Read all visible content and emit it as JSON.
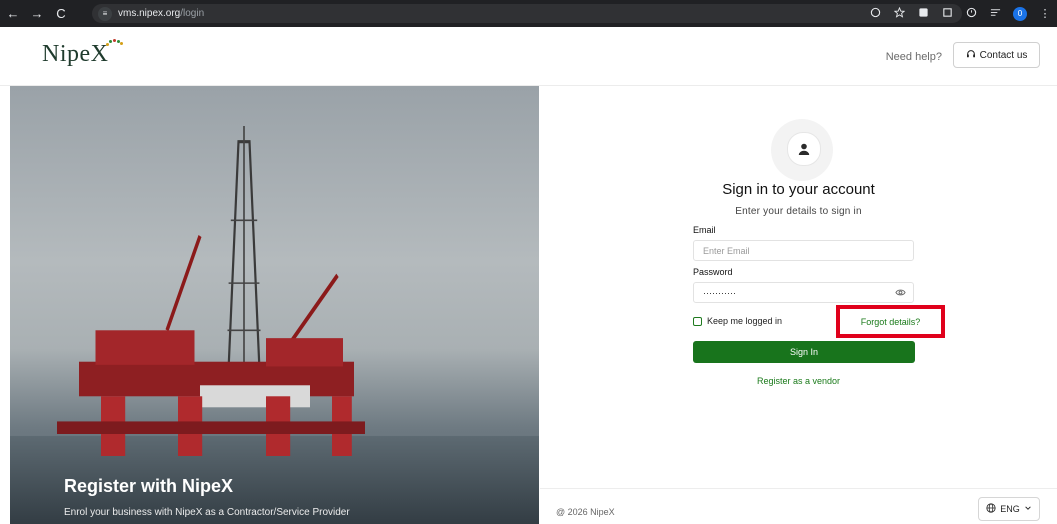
{
  "browser": {
    "back_icon": "←",
    "forward_icon": "→",
    "reload_icon": "C",
    "site_icon": "≡",
    "url_host": "vms.nipex.org",
    "url_path": "/login",
    "profile_initial": "0"
  },
  "header": {
    "logo_text": "NipeX",
    "need_help": "Need help?",
    "contact_label": "Contact us",
    "logo_dot_colors": [
      "#d4a017",
      "#2e8b3a",
      "#c0392b",
      "#2e8b3a",
      "#d4a017"
    ]
  },
  "hero": {
    "title": "Register with NipeX",
    "subtitle": "Enrol your business with NipeX as a Contractor/Service Provider"
  },
  "form": {
    "title": "Sign in to your account",
    "subtitle": "Enter your details to sign in",
    "email_label": "Email",
    "email_placeholder": "Enter Email",
    "password_label": "Password",
    "password_value": "···········",
    "keep_logged_in": "Keep me logged in",
    "forgot": "Forgot details?",
    "signin": "Sign In",
    "register": "Register as a vendor"
  },
  "footer": {
    "copyright": "@ 2026 NipeX",
    "language": "ENG"
  },
  "colors": {
    "primary_green": "#18741c",
    "link_green": "#1a7a1a",
    "highlight_red": "#e0001b"
  }
}
